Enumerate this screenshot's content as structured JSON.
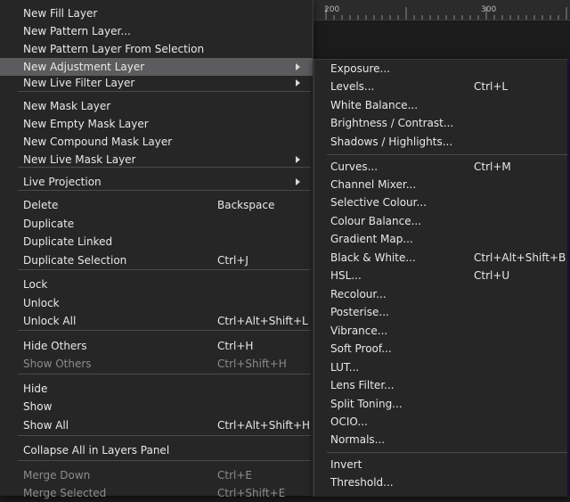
{
  "ruler": {
    "marks": [
      "200",
      "300"
    ]
  },
  "main_menu": {
    "items": [
      {
        "label": "New Fill Layer"
      },
      {
        "label": "New Pattern Layer..."
      },
      {
        "label": "New Pattern Layer From Selection"
      },
      {
        "label": "New Adjustment Layer",
        "submenu": true,
        "highlighted": true
      },
      {
        "label": "New Live Filter Layer",
        "submenu": true
      },
      {
        "label": "New Mask Layer"
      },
      {
        "label": "New Empty Mask Layer"
      },
      {
        "label": "New Compound Mask Layer"
      },
      {
        "label": "New Live Mask Layer",
        "submenu": true
      },
      {
        "label": "Live Projection",
        "submenu": true
      },
      {
        "label": "Delete",
        "shortcut": "Backspace"
      },
      {
        "label": "Duplicate"
      },
      {
        "label": "Duplicate Linked"
      },
      {
        "label": "Duplicate Selection",
        "shortcut": "Ctrl+J"
      },
      {
        "label": "Lock"
      },
      {
        "label": "Unlock"
      },
      {
        "label": "Unlock All",
        "shortcut": "Ctrl+Alt+Shift+L"
      },
      {
        "label": "Hide Others",
        "shortcut": "Ctrl+H"
      },
      {
        "label": "Show Others",
        "shortcut": "Ctrl+Shift+H",
        "disabled": true
      },
      {
        "label": "Hide"
      },
      {
        "label": "Show"
      },
      {
        "label": "Show All",
        "shortcut": "Ctrl+Alt+Shift+H"
      },
      {
        "label": "Collapse All in Layers Panel"
      },
      {
        "label": "Merge Down",
        "shortcut": "Ctrl+E",
        "disabled": true
      },
      {
        "label": "Merge Selected",
        "shortcut": "Ctrl+Shift+E",
        "disabled": true
      }
    ]
  },
  "adjustment_submenu": {
    "items": [
      {
        "label": "Exposure..."
      },
      {
        "label": "Levels...",
        "shortcut": "Ctrl+L"
      },
      {
        "label": "White Balance..."
      },
      {
        "label": "Brightness / Contrast..."
      },
      {
        "label": "Shadows / Highlights..."
      },
      {
        "label": "Curves...",
        "shortcut": "Ctrl+M"
      },
      {
        "label": "Channel Mixer..."
      },
      {
        "label": "Selective Colour..."
      },
      {
        "label": "Colour Balance..."
      },
      {
        "label": "Gradient Map..."
      },
      {
        "label": "Black & White...",
        "shortcut": "Ctrl+Alt+Shift+B"
      },
      {
        "label": "HSL...",
        "shortcut": "Ctrl+U"
      },
      {
        "label": "Recolour..."
      },
      {
        "label": "Posterise..."
      },
      {
        "label": "Vibrance..."
      },
      {
        "label": "Soft Proof..."
      },
      {
        "label": "LUT..."
      },
      {
        "label": "Lens Filter..."
      },
      {
        "label": "Split Toning..."
      },
      {
        "label": "OCIO..."
      },
      {
        "label": "Normals..."
      },
      {
        "label": "Invert"
      },
      {
        "label": "Threshold..."
      }
    ]
  }
}
